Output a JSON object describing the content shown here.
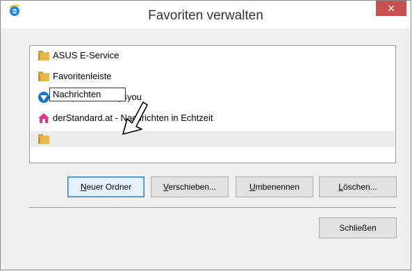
{
  "window": {
    "title": "Favoriten verwalten",
    "close_label": "×"
  },
  "list": {
    "items": [
      {
        "label": "ASUS E-Service",
        "icon": "folder-icon"
      },
      {
        "label": "Favoritenleiste",
        "icon": "folder-icon"
      },
      {
        "label": "Computertraining4you",
        "icon": "site-shield-icon"
      },
      {
        "label": "derStandard.at - Nachrichten in Echtzeit",
        "icon": "home-site-icon"
      },
      {
        "label": "Nachrichten",
        "icon": "folder-icon",
        "editing": true
      }
    ]
  },
  "buttons": {
    "new_folder": {
      "acc": "N",
      "rest": "euer Ordner"
    },
    "move": {
      "acc": "V",
      "rest": "erschieben..."
    },
    "rename": {
      "acc": "U",
      "rest": "mbenennen"
    },
    "delete": {
      "acc": "L",
      "rest": "öschen..."
    },
    "close": "Schließen"
  },
  "colors": {
    "accent": "#3c7fb1",
    "close_bg": "#c75050",
    "folder": "#e8b84a"
  }
}
